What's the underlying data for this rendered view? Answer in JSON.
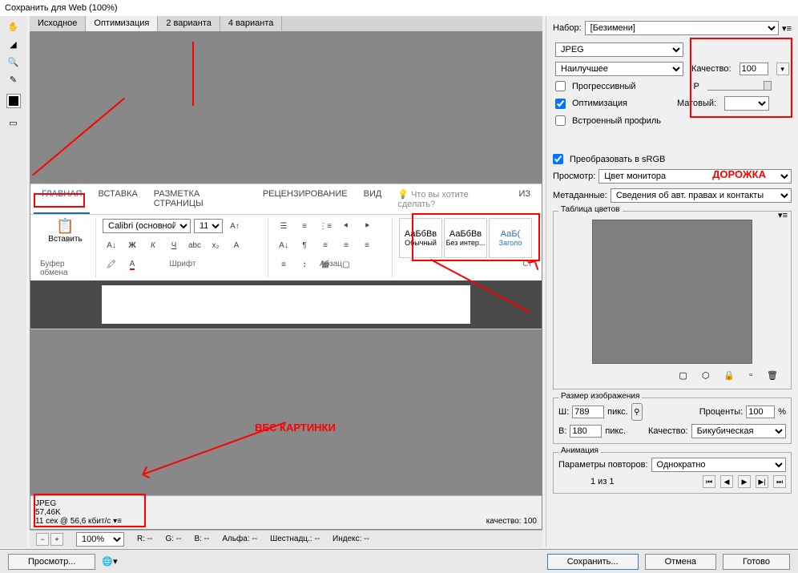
{
  "title": "Сохранить для Web (100%)",
  "tabs": [
    "Исходное",
    "Оптимизация",
    "2 варианта",
    "4 варианта"
  ],
  "active_tab": 1,
  "ribbon": {
    "tabs": [
      "ГЛАВНАЯ",
      "ВСТАВКА",
      "РАЗМЕТКА СТРАНИЦЫ",
      "РЕЦЕНЗИРОВАНИЕ",
      "ВИД"
    ],
    "tell_me": "Что вы хотите сделать?",
    "iz": "ИЗ",
    "paste": "Вставить",
    "clipboard": "Буфер обмена",
    "font_name": "Calibri (основной)",
    "font_size": "11",
    "font_group": "Шрифт",
    "para_group": "Абзац",
    "styles_group": "Ст",
    "style1_prev": "АаБбВв",
    "style1_lbl": "Обычный",
    "style2_prev": "АаБбВв",
    "style2_lbl": "Без интер...",
    "style3_prev": "АаБ(",
    "style3_lbl": "Заголо"
  },
  "info": {
    "fmt": "JPEG",
    "size": "57,46K",
    "time": "11 сек @ 56,6 кбит/с",
    "quality": "качество: 100"
  },
  "status": {
    "zoom": "100%",
    "r": "R: --",
    "g": "G: --",
    "b": "B: --",
    "alpha": "Альфа: --",
    "hex": "Шестнадц.: --",
    "index": "Индекс: --"
  },
  "right": {
    "preset_lbl": "Набор:",
    "preset": "[Безимени]",
    "format": "JPEG",
    "quality_preset": "Наилучшее",
    "quality_lbl": "Качество:",
    "quality": "100",
    "progressive": "Прогрессивный",
    "p": "Р",
    "optimize": "Оптимизация",
    "matte_lbl": "Матовый:",
    "embed_profile": "Встроенный профиль",
    "convert_srgb": "Преобразовать в sRGB",
    "preview_lbl": "Просмотр:",
    "preview": "Цвет монитора",
    "metadata_lbl": "Метаданные:",
    "metadata": "Сведения об авт. правах и контакты",
    "colortable": "Таблица цветов",
    "imgsize": "Размер изображения",
    "w_lbl": "Ш:",
    "w": "789",
    "px": "пикс.",
    "h_lbl": "В:",
    "h": "180",
    "percent_lbl": "Проценты:",
    "percent": "100",
    "pct": "%",
    "resample_lbl": "Качество:",
    "resample": "Бикубическая",
    "anim": "Анимация",
    "loop_lbl": "Параметры повторов:",
    "loop": "Однократно",
    "page": "1 из 1"
  },
  "footer": {
    "preview": "Просмотр...",
    "save": "Сохранить...",
    "cancel": "Отмена",
    "done": "Готово"
  },
  "ann": {
    "weight": "ВЕС КАРТИНКИ",
    "track": "ДОРОЖКА"
  }
}
